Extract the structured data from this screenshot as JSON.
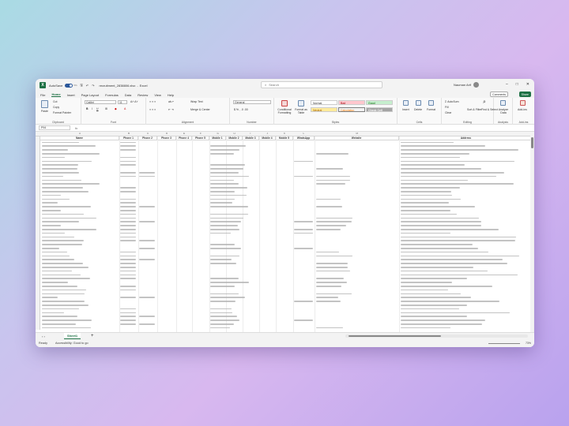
{
  "titlebar": {
    "autosave_label": "AutoSave",
    "autosave_state": "On",
    "filename": "recruitment_2838806.xlsx",
    "app": "Excel",
    "search_placeholder": "Search",
    "user_name": "Nauman Arif"
  },
  "menu": [
    "File",
    "Home",
    "Insert",
    "Page Layout",
    "Formulas",
    "Data",
    "Review",
    "View",
    "Help"
  ],
  "menu_active": "Home",
  "comments_label": "Comments",
  "share_label": "Share",
  "ribbon": {
    "clipboard": {
      "paste": "Paste",
      "cut": "Cut",
      "copy": "Copy",
      "format_painter": "Format Painter",
      "label": "Clipboard"
    },
    "font": {
      "name": "Calibri",
      "size": "11",
      "label": "Font"
    },
    "alignment": {
      "wrap": "Wrap Text",
      "merge": "Merge & Center",
      "label": "Alignment"
    },
    "number": {
      "format": "General",
      "label": "Number"
    },
    "styles": {
      "conditional": "Conditional Formatting",
      "format_table": "Format as Table",
      "normal": "Normal",
      "bad": "Bad",
      "good": "Good",
      "neutral": "Neutral",
      "calculation": "Calculation",
      "check_cell": "Check Cell",
      "label": "Styles"
    },
    "cells": {
      "insert": "Insert",
      "delete": "Delete",
      "format": "Format",
      "label": "Cells"
    },
    "editing": {
      "autosum": "AutoSum",
      "fill": "Fill",
      "clear": "Clear",
      "sort": "Sort & Filter",
      "find": "Find & Select",
      "label": "Editing"
    },
    "analysis": {
      "analyze": "Analyze Data",
      "label": "Analysis"
    },
    "addins": {
      "addins": "Add-ins",
      "label": "Add-ins"
    }
  },
  "formula_bar": {
    "name_box": "P94",
    "fx": "fx"
  },
  "columns": {
    "letters": [
      "A",
      "B",
      "C",
      "D",
      "E",
      "F",
      "G",
      "H",
      "I",
      "J",
      "K",
      "L",
      "M"
    ],
    "headers": [
      "Name",
      "Phone 1",
      "Phone 2",
      "Phone 3",
      "Phone 4",
      "Phone 5",
      "Mobile 1",
      "Mobile 2",
      "Mobile 3",
      "Mobile 4",
      "Mobile 5",
      "WhatsApp",
      "Website",
      "Address"
    ]
  },
  "row_count": 50,
  "sheet_tab": "Sheet1",
  "status": {
    "ready": "Ready",
    "accessibility": "Accessibility: Good to go",
    "zoom": "73%"
  }
}
